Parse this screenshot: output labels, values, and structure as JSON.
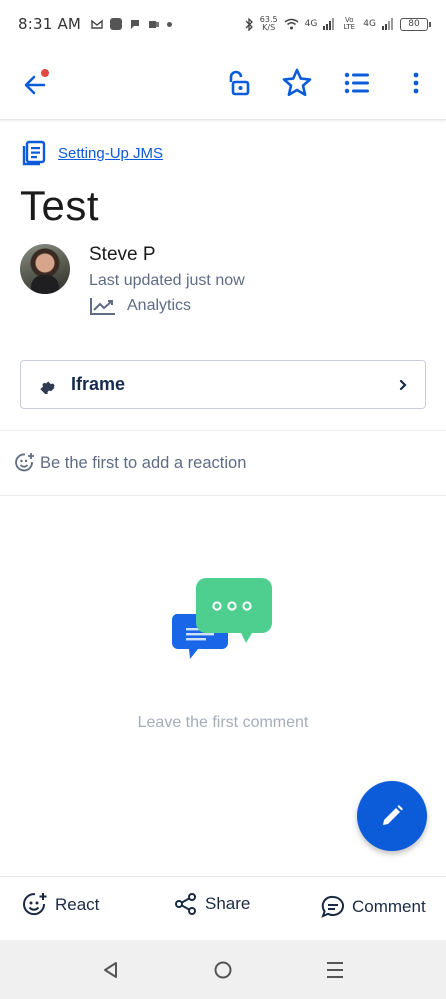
{
  "status_bar": {
    "time": "8:31 AM",
    "speed_value": "63.5",
    "speed_unit": "K/S",
    "net1": "4G",
    "volte": "Vo LTE",
    "net2": "4G",
    "battery": "80"
  },
  "app_bar": {
    "icons": [
      "back-arrow-icon",
      "unlock-icon",
      "star-icon",
      "list-icon",
      "more-vertical-icon"
    ]
  },
  "breadcrumb": {
    "label": "Setting-Up JMS"
  },
  "page": {
    "title": "Test"
  },
  "author": {
    "name": "Steve P",
    "updated": "Last updated just now",
    "analytics_label": "Analytics"
  },
  "macro": {
    "label": "Iframe"
  },
  "reactions": {
    "prompt": "Be the first to add a reaction"
  },
  "comments": {
    "empty_text": "Leave the first comment"
  },
  "bottom_actions": {
    "react": "React",
    "share": "Share",
    "comment": "Comment"
  },
  "colors": {
    "brand_blue": "#0c5bd8",
    "notification": "#e2483d",
    "bubble_green": "#4fcf8f",
    "muted_text": "#5e6c84"
  }
}
